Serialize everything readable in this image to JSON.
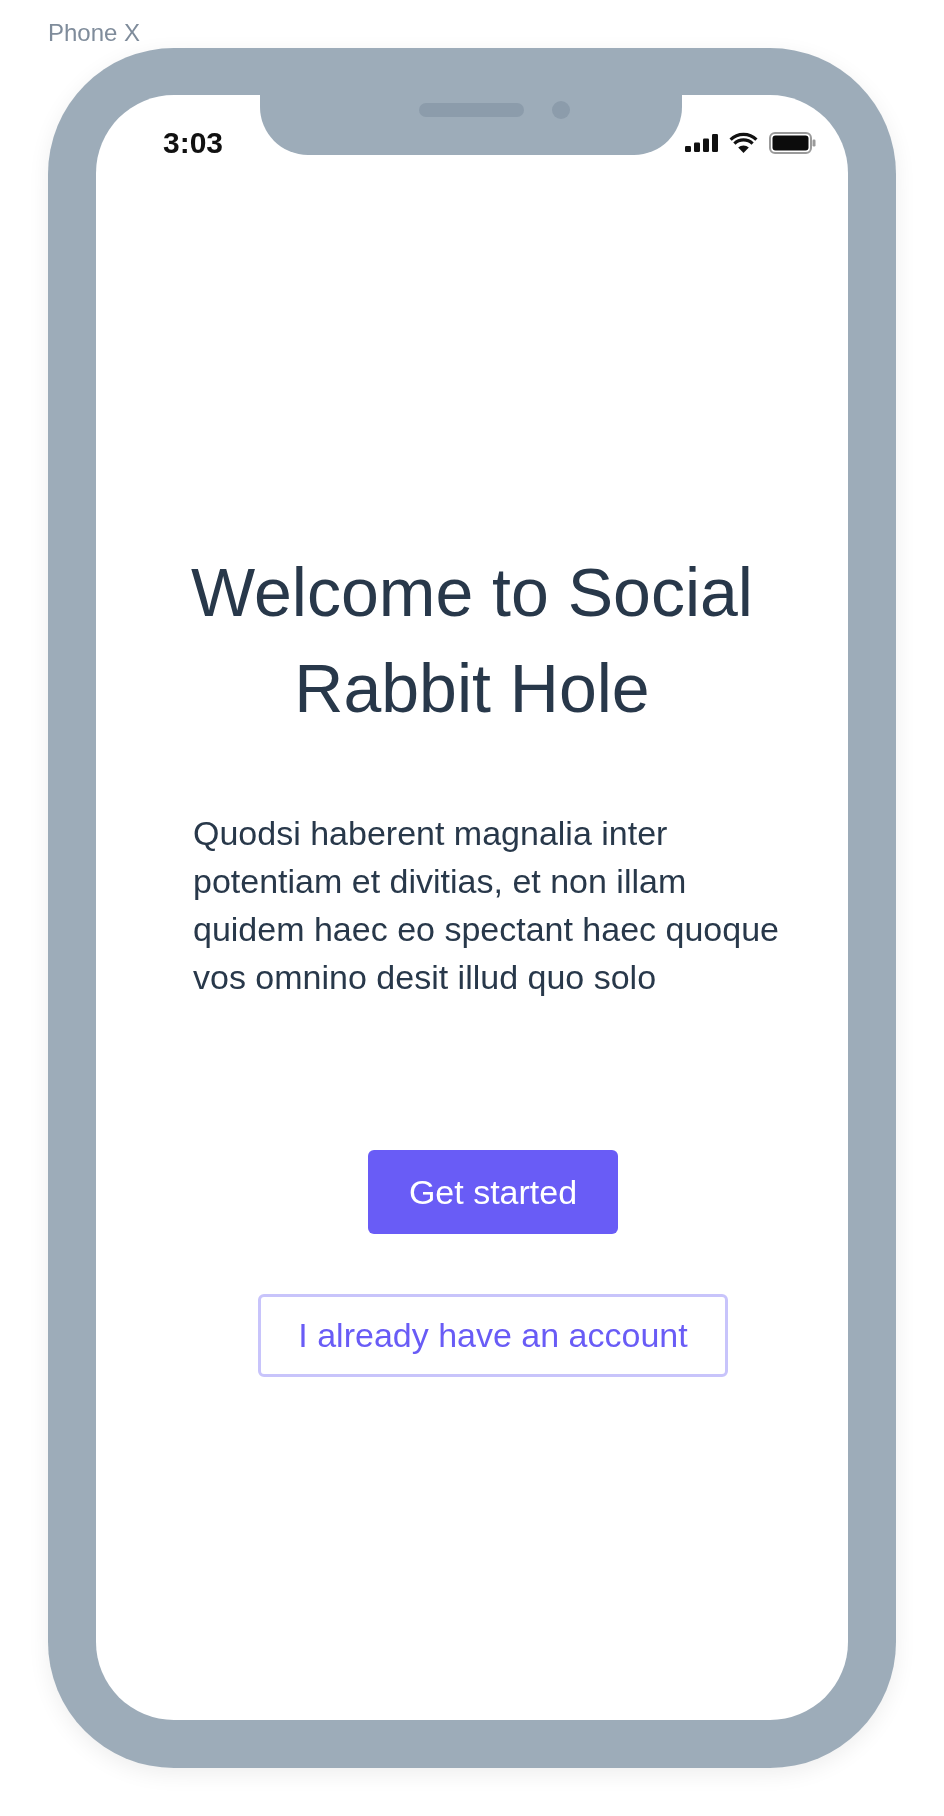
{
  "canvas_label": "Phone X",
  "status_bar": {
    "time": "3:03"
  },
  "welcome": {
    "title": "Welcome to Social Rabbit Hole",
    "body": "Quodsi haberent magnalia inter potentiam et divitias, et non illam quidem haec eo spectant haec quoque vos omnino desit illud quo solo"
  },
  "buttons": [
    {
      "label": "Get started",
      "kind": "primary"
    },
    {
      "label": "I already have an account",
      "kind": "secondary"
    }
  ]
}
